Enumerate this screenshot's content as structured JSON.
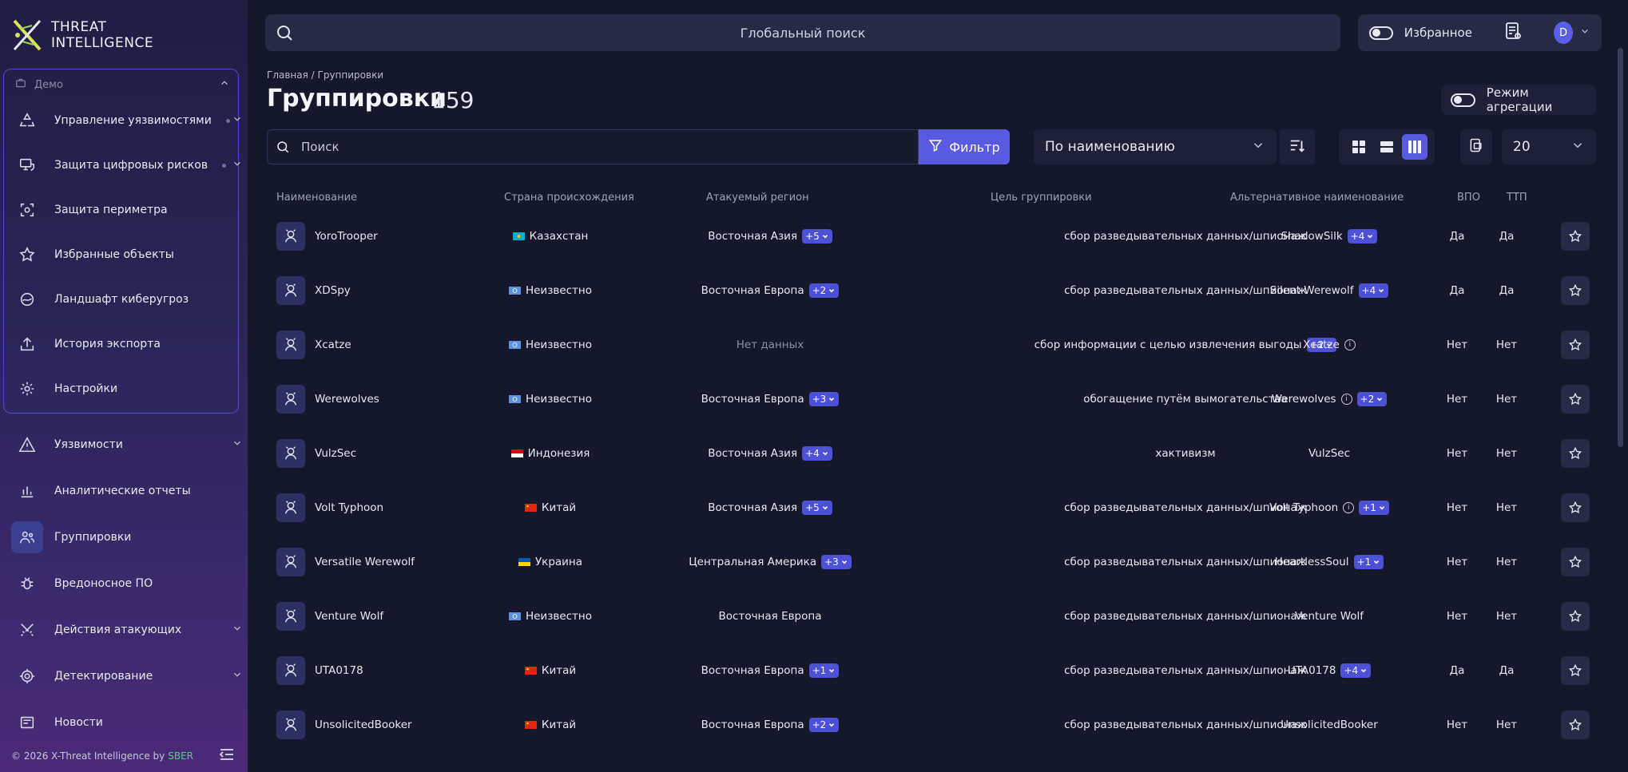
{
  "brand": {
    "line1": "THREAT",
    "line2": "INTELLIGENCE"
  },
  "sidebar": {
    "demo_label": "Демо",
    "demo_items": [
      {
        "label": "Управление уязвимостями",
        "icon": "recycle-icon"
      },
      {
        "label": "Защита цифровых рисков",
        "icon": "monitor-shield-icon"
      },
      {
        "label": "Защита периметра",
        "icon": "perimeter-icon"
      },
      {
        "label": "Избранные объекты",
        "icon": "star-icon"
      },
      {
        "label": "Ландшафт киберугроз",
        "icon": "landscape-icon"
      },
      {
        "label": "История экспорта",
        "icon": "upload-icon"
      },
      {
        "label": "Настройки",
        "icon": "gear-icon"
      }
    ],
    "items": [
      {
        "label": "Уязвимости",
        "icon": "warning-icon"
      },
      {
        "label": "Аналитические отчеты",
        "icon": "chart-icon"
      },
      {
        "label": "Группировки",
        "icon": "group-icon"
      },
      {
        "label": "Вредоносное ПО",
        "icon": "bug-icon"
      },
      {
        "label": "Действия атакующих",
        "icon": "swords-icon"
      },
      {
        "label": "Детектирование",
        "icon": "target-icon"
      },
      {
        "label": "Новости",
        "icon": "news-icon"
      }
    ],
    "footer": "© 2026 X-Threat Intelligence by",
    "footer_brand": "SBER"
  },
  "topbar": {
    "search_placeholder": "Глобальный поиск",
    "favorites_label": "Избранное",
    "avatar": "D"
  },
  "breadcrumb": "Главная  /  Группировки",
  "page": {
    "title": "Группировки",
    "count": "159",
    "aggregation_label": "Режим агрегации"
  },
  "toolbar": {
    "search_placeholder": "Поиск",
    "filter_label": "Фильтр",
    "sort_value": "По наименованию",
    "per_page": "20"
  },
  "table": {
    "headers": [
      "Наименование",
      "Страна происхождения",
      "Атакуемый регион",
      "Цель группировки",
      "Альтернативное наименование",
      "ВПО",
      "ТТП"
    ],
    "rows": [
      {
        "name": "YoroTrooper",
        "country": "Казахстан",
        "flag": "kz",
        "region": "Восточная Азия",
        "region_more": "+5",
        "goal": "сбор разведывательных данных/шпионаж",
        "goal_more": "",
        "alt": "ShadowSilk",
        "alt_info": false,
        "alt_more": "+4",
        "vpo": "Да",
        "ttp": "Да"
      },
      {
        "name": "XDSpy",
        "country": "Неизвестно",
        "flag": "un",
        "region": "Восточная Европа",
        "region_more": "+2",
        "goal": "сбор разведывательных данных/шпионаж",
        "goal_more": "",
        "alt": "Silent Werewolf",
        "alt_info": false,
        "alt_more": "+4",
        "vpo": "Да",
        "ttp": "Да"
      },
      {
        "name": "Xcatze",
        "country": "Неизвестно",
        "flag": "un",
        "region": "Нет данных",
        "region_more": "",
        "goal": "сбор информации с целью извлечения выгоды",
        "goal_more": "+2",
        "alt": "Xcatze",
        "alt_info": true,
        "alt_more": "",
        "vpo": "Нет",
        "ttp": "Нет"
      },
      {
        "name": "Werewolves",
        "country": "Неизвестно",
        "flag": "un",
        "region": "Восточная Европа",
        "region_more": "+3",
        "goal": "обогащение путём вымогательства",
        "goal_more": "",
        "alt": "Werewolves",
        "alt_info": true,
        "alt_more": "+2",
        "vpo": "Нет",
        "ttp": "Нет"
      },
      {
        "name": "VulzSec",
        "country": "Индонезия",
        "flag": "id",
        "region": "Восточная Азия",
        "region_more": "+4",
        "goal": "хактивизм",
        "goal_more": "",
        "alt": "VulzSec",
        "alt_info": false,
        "alt_more": "",
        "vpo": "Нет",
        "ttp": "Нет"
      },
      {
        "name": "Volt Typhoon",
        "country": "Китай",
        "flag": "cn",
        "region": "Восточная Азия",
        "region_more": "+5",
        "goal": "сбор разведывательных данных/шпионаж",
        "goal_more": "",
        "alt": "Volt Typhoon",
        "alt_info": true,
        "alt_more": "+1",
        "vpo": "Нет",
        "ttp": "Нет"
      },
      {
        "name": "Versatile Werewolf",
        "country": "Украина",
        "flag": "ua",
        "region": "Центральная Америка",
        "region_more": "+3",
        "goal": "сбор разведывательных данных/шпионаж",
        "goal_more": "",
        "alt": "HeartlessSoul",
        "alt_info": false,
        "alt_more": "+1",
        "vpo": "Нет",
        "ttp": "Нет"
      },
      {
        "name": "Venture Wolf",
        "country": "Неизвестно",
        "flag": "un",
        "region": "Восточная Европа",
        "region_more": "",
        "goal": "сбор разведывательных данных/шпионаж",
        "goal_more": "",
        "alt": "Venture Wolf",
        "alt_info": false,
        "alt_more": "",
        "vpo": "Нет",
        "ttp": "Нет"
      },
      {
        "name": "UTA0178",
        "country": "Китай",
        "flag": "cn",
        "region": "Восточная Европа",
        "region_more": "+1",
        "goal": "сбор разведывательных данных/шпионаж",
        "goal_more": "",
        "alt": "UTA0178",
        "alt_info": false,
        "alt_more": "+4",
        "vpo": "Да",
        "ttp": "Да"
      },
      {
        "name": "UnsolicitedBooker",
        "country": "Китай",
        "flag": "cn",
        "region": "Восточная Европа",
        "region_more": "+2",
        "goal": "сбор разведывательных данных/шпионаж",
        "goal_more": "",
        "alt": "UnsolicitedBooker",
        "alt_info": false,
        "alt_more": "",
        "vpo": "Нет",
        "ttp": "Нет"
      }
    ]
  },
  "colors": {
    "accent": "#5a5ae0",
    "badge": "#4d51d6",
    "background": "#15172a",
    "sber": "#4bd27a"
  }
}
